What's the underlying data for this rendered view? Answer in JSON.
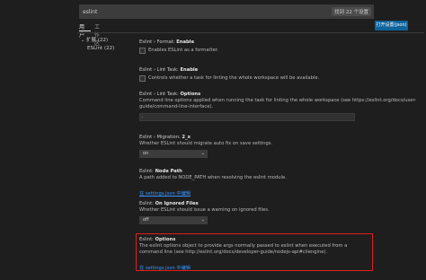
{
  "search": {
    "value": "eslint",
    "result_count": "找到 22 个设置"
  },
  "tabs": [
    {
      "label": "用户"
    },
    {
      "label": "工作区"
    }
  ],
  "open_json_button": "打开设置(json)",
  "tree": {
    "root": "扩展 (22)",
    "child": "ESLint (22)"
  },
  "settings": [
    {
      "category": "Eslint › Format: ",
      "name": "Enable",
      "checkbox_label": "Enables ESLint as a formatter."
    },
    {
      "category": "Eslint › Lint Task: ",
      "name": "Enable",
      "checkbox_label": "Controls whether a task for linting the whole workspace will be available."
    },
    {
      "category": "Eslint › Lint Task: ",
      "name": "Options",
      "description": "Command line options applied when running the task for linting the whole workspace (see https://eslint.org/docs/user-guide/command-line-interface).",
      "field_value": "."
    },
    {
      "category": "Eslint › Migration: ",
      "name": "2_x",
      "description": "Whether ESLint should migrate auto fix on save settings.",
      "select_value": "on"
    },
    {
      "category": "Eslint: ",
      "name": "Node Path",
      "description": "A path added to NODE_PATH when resolving the eslint module.",
      "link": "在 settings.json 中编辑"
    },
    {
      "category": "Eslint: ",
      "name": "On Ignored Files",
      "description": "Whether ESLint should issue a warning on ignored files.",
      "select_value": "off"
    },
    {
      "category": "Eslint: ",
      "name": "Options",
      "description": "The eslint options object to provide args normally passed to eslint when executed from a command line (see http://eslint.org/docs/developer-guide/nodejs-api#cliengine).",
      "link": "在 settings.json 中编辑"
    }
  ],
  "colors": {
    "accent": "#0e639c",
    "highlight": "#e01e1e",
    "link": "#3794ff"
  }
}
